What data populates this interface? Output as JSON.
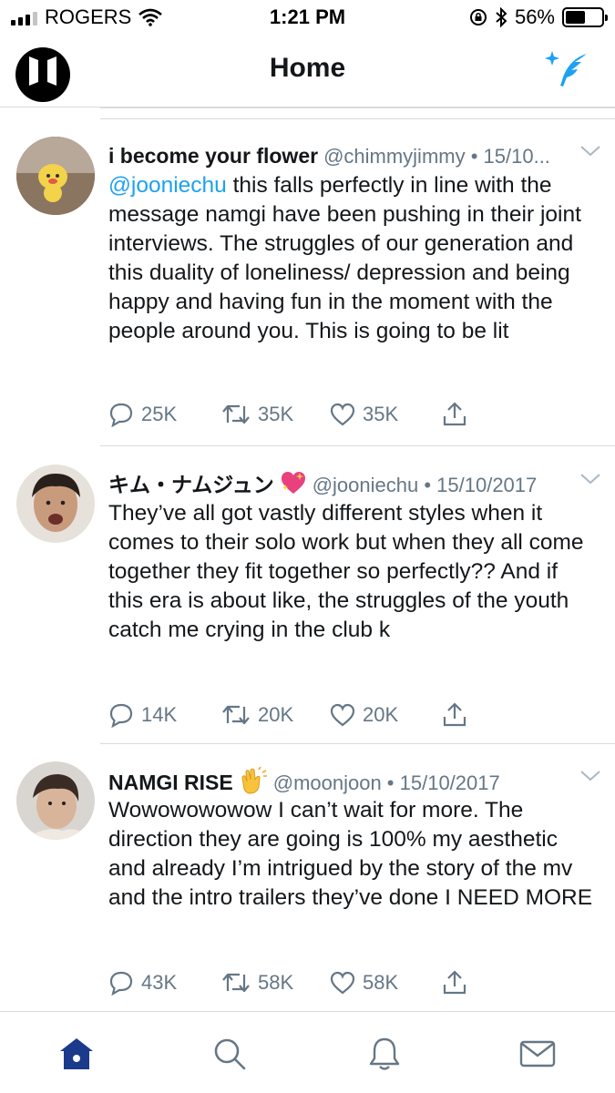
{
  "status_bar": {
    "carrier": "ROGERS",
    "time": "1:21 PM",
    "battery_percent": "56%",
    "battery_level": 0.56
  },
  "nav": {
    "title": "Home",
    "profile_logo_text": "BTS",
    "compose_icon": "compose-feather-icon"
  },
  "tweets": [
    {
      "display_name": "i become your flower",
      "meta": "@chimmyjimmy • 15/10...",
      "mention": "@jooniechu",
      "text": " this falls perfectly in line with the message namgi have been pushing in their joint interviews. The struggles of our generation and this duality of loneliness/ depression and being happy and having fun in the moment with the people around you. This is going to be lit",
      "replies": "25K",
      "retweets": "35K",
      "likes": "35K"
    },
    {
      "display_name": "キム・ナムジュン",
      "name_emoji": "sparkling-heart",
      "meta": "@jooniechu • 15/10/2017",
      "text": "They’ve all got vastly different styles when it comes to their solo work but when they all come together they fit together so perfectly?? And if this era is about like, the struggles of the youth catch me crying in the club k",
      "replies": "14K",
      "retweets": "20K",
      "likes": "20K"
    },
    {
      "display_name": "NAMGI RISE",
      "name_emoji": "clapping-hands",
      "meta": "@moonjoon • 15/10/2017",
      "text": "Wowowowowow I can’t wait for more. The direction they are going is 100% my aesthetic and already I’m intrigued by the story of the mv and the intro trailers they’ve done I NEED MORE",
      "replies": "43K",
      "retweets": "58K",
      "likes": "58K"
    }
  ],
  "tab_bar": {
    "tabs": [
      "home-icon",
      "search-icon",
      "notifications-bell-icon",
      "messages-envelope-icon"
    ],
    "active": "home-icon"
  },
  "colors": {
    "accent": "#1da1f2",
    "text": "#14171a",
    "secondary": "#657786",
    "divider": "#d6dbdf",
    "active_tab": "#1b3a8c"
  }
}
